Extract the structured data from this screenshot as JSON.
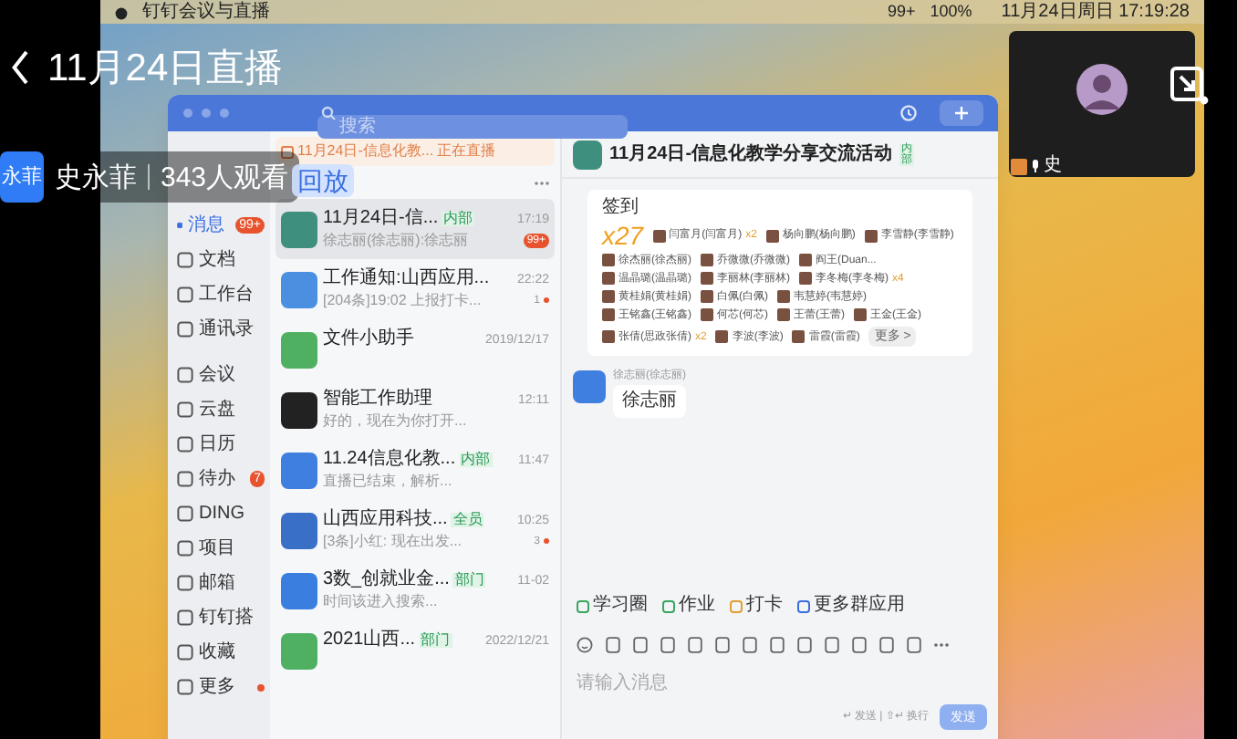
{
  "menu_bar": {
    "app_name": "钉钉会议与直播",
    "status_items": [
      "99+",
      "100%"
    ],
    "clock": "11月24日周日 17:19:28"
  },
  "dingtalk": {
    "search": {
      "placeholder": "搜索"
    },
    "sidebar": [
      {
        "label": "消息",
        "selected": true,
        "badge": "99+"
      },
      {
        "label": "文档",
        "selected": false
      },
      {
        "label": "工作台",
        "selected": false
      },
      {
        "label": "通讯录",
        "selected": false
      },
      {
        "label": "会议",
        "selected": false
      },
      {
        "label": "云盘",
        "selected": false
      },
      {
        "label": "日历",
        "selected": false
      },
      {
        "label": "待办",
        "selected": false,
        "badge": "7"
      },
      {
        "label": "DING",
        "selected": false
      },
      {
        "label": "项目",
        "selected": false
      },
      {
        "label": "邮箱",
        "selected": false
      },
      {
        "label": "钉钉搭",
        "selected": false
      },
      {
        "label": "收藏",
        "selected": false
      },
      {
        "label": "更多",
        "selected": false,
        "dot": true
      }
    ],
    "live_tab": {
      "title": "11月24日-信息化教...",
      "status": "正在直播"
    },
    "conversations": [
      {
        "title": "11月24日-信...",
        "tag": "内部",
        "time": "17:19",
        "preview": "徐志丽(徐志丽):徐志丽",
        "badge": "99+",
        "color": "#3f8f7f",
        "selected": true
      },
      {
        "title": "工作通知:山西应用...",
        "time": "22:22",
        "preview": "[204条]19:02 上报打卡...",
        "unread": "1",
        "color": "#4a8fe0",
        "selected": false
      },
      {
        "title": "文件小助手",
        "time": "2019/12/17",
        "color": "#4fb061",
        "selected": false
      },
      {
        "title": "智能工作助理",
        "time": "12:11",
        "preview": "好的，现在为你打开...",
        "color": "#222222",
        "selected": false
      },
      {
        "title": "11.24信息化教...",
        "tag": "内部",
        "time": "11:47",
        "preview": "直播已结束，解析...",
        "color": "#3f7fe0",
        "selected": false
      },
      {
        "title": "山西应用科技...",
        "tag": "全员",
        "time": "10:25",
        "preview": "[3条]小红: 现在出发...",
        "unread": "3",
        "color": "#3a6fc8",
        "selected": false
      },
      {
        "title": "3数_创就业金...",
        "tag": "部门",
        "time": "11-02",
        "preview": "时间该进入搜索...",
        "color": "#3a7fe0",
        "selected": false
      },
      {
        "title": "2021山西...",
        "tag": "部门",
        "time": "2022/12/21",
        "color": "#4fb061",
        "selected": false
      }
    ],
    "chat": {
      "title": "11月24日-信息化教学分享交流活动",
      "tag": "内部",
      "checkin": {
        "label": "签到",
        "count": "x27",
        "attendees": [
          {
            "name": "闫富月(闫富月)",
            "times": "x2"
          },
          {
            "name": "杨向鹏(杨向鹏)"
          },
          {
            "name": "李雪静(李雪静)"
          },
          {
            "name": "徐杰丽(徐杰丽)"
          },
          {
            "name": "乔微微(乔微微)"
          },
          {
            "name": "阎王(Duan..."
          },
          {
            "name": "温晶璐(温晶璐)"
          },
          {
            "name": "李丽林(李丽林)"
          },
          {
            "name": "李冬梅(李冬梅)",
            "times": "x4"
          },
          {
            "name": "黄桂娟(黄桂娟)"
          },
          {
            "name": "白佩(白佩)"
          },
          {
            "name": "韦慧婷(韦慧婷)"
          },
          {
            "name": "王铭鑫(王铭鑫)"
          },
          {
            "name": "何芯(何芯)"
          },
          {
            "name": "王蕾(王蕾)"
          },
          {
            "name": "王金(王金)"
          },
          {
            "name": "张倩(思政张倩)",
            "times": "x2"
          },
          {
            "name": "李波(李波)"
          },
          {
            "name": "雷霞(雷霞)"
          }
        ],
        "more": "更多 >"
      },
      "message": {
        "sender": "徐志丽(徐志丽)",
        "text": "徐志丽"
      },
      "apps": [
        "学习圈",
        "作业",
        "打卡",
        "更多群应用"
      ],
      "input": {
        "placeholder": "请输入消息"
      },
      "hint": "↵ 发送 | ⇧↵ 换行",
      "send": "发送"
    }
  },
  "live": {
    "title": "11月24日直播",
    "host_avatar": "永菲",
    "host_name": "史永菲",
    "viewers": "343人观看",
    "replay_badge": "回放",
    "camera": {
      "caption": "史"
    }
  }
}
